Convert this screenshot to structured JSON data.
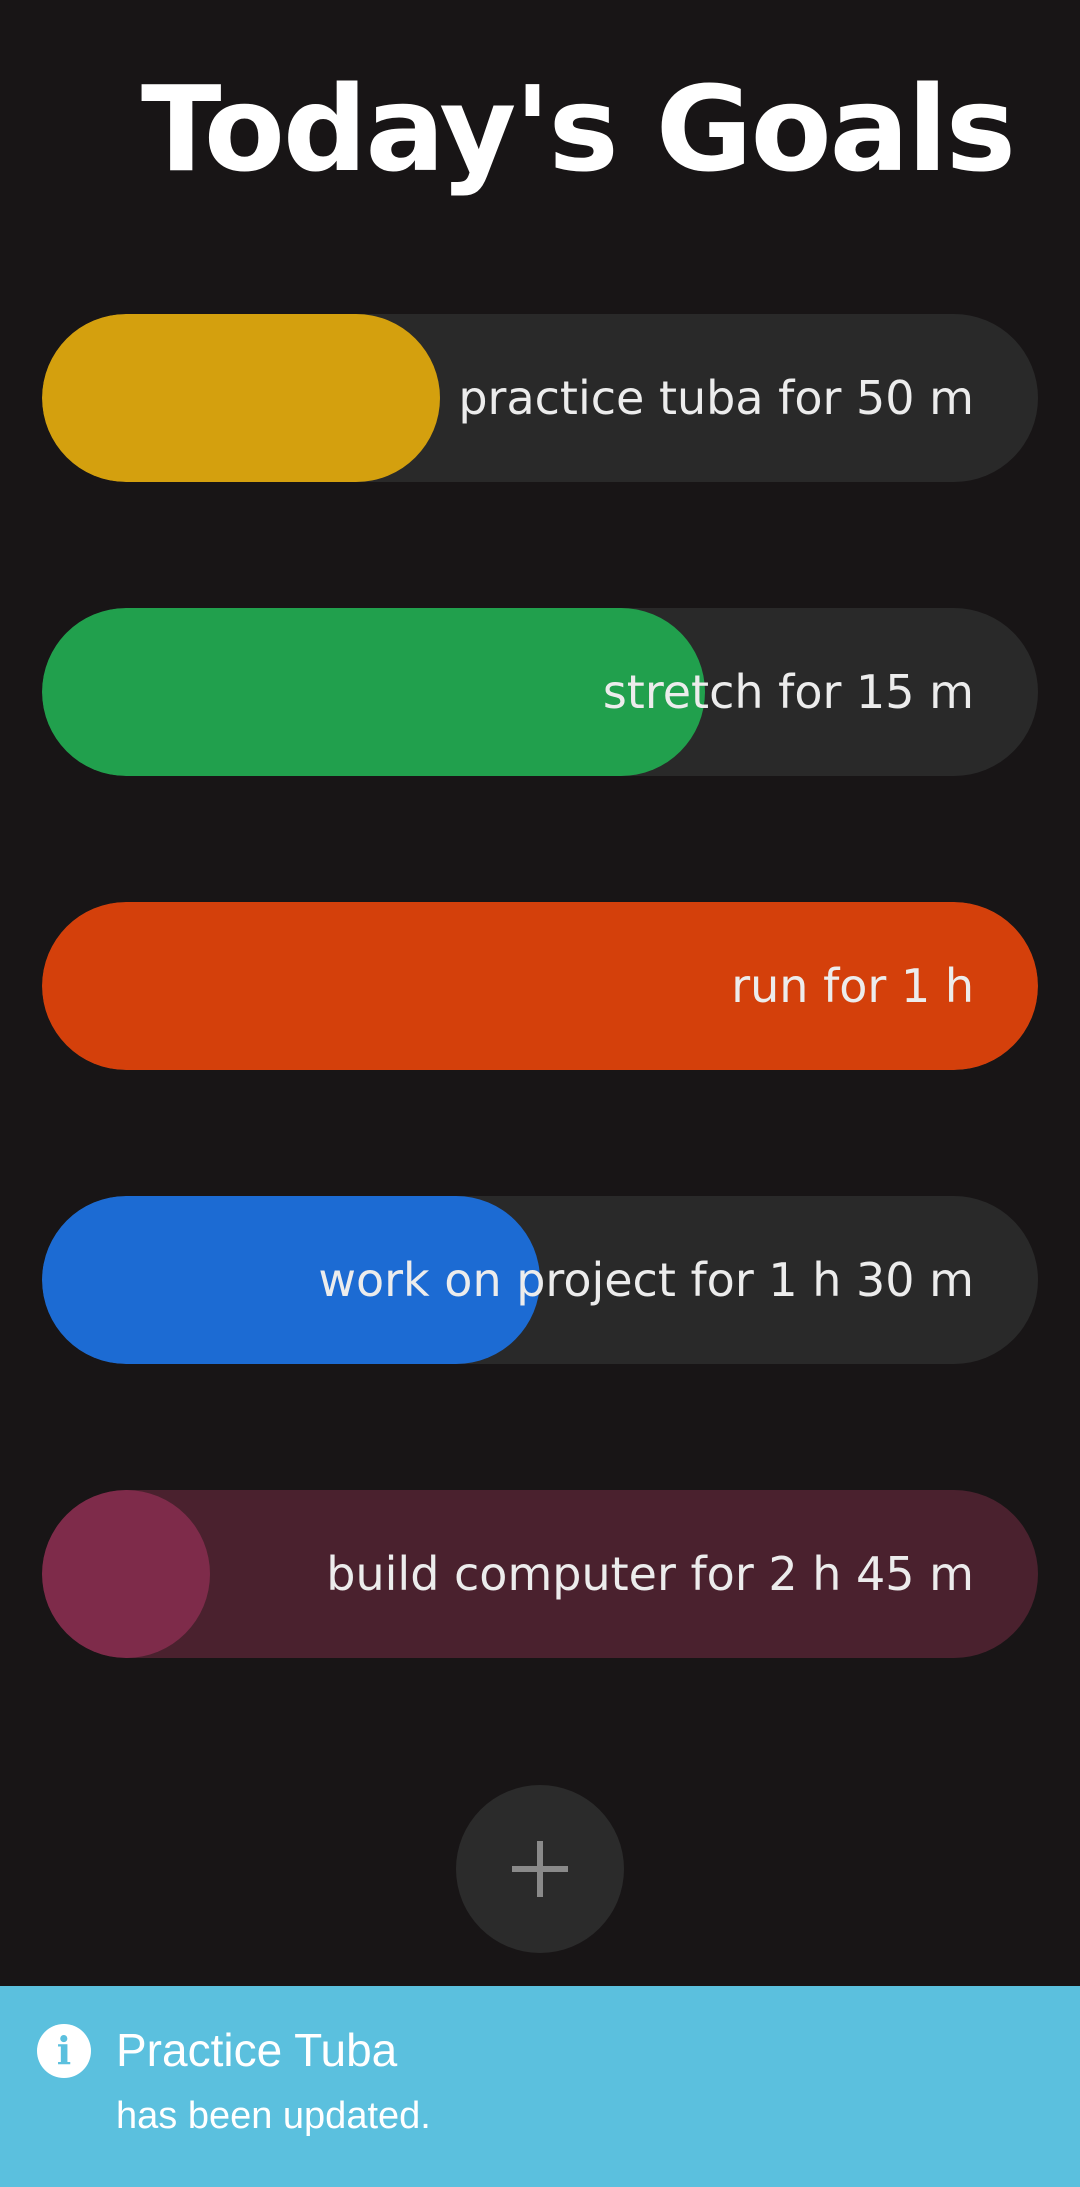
{
  "header": {
    "title": "Today's Goals"
  },
  "goals": [
    {
      "label": "practice tuba for 50 m",
      "progress": 0.4,
      "fill_color": "#d4a00e",
      "track_color": "#292929"
    },
    {
      "label": "stretch for 15 m",
      "progress": 0.666,
      "fill_color": "#21a04d",
      "track_color": "#292929"
    },
    {
      "label": "run for 1 h",
      "progress": 1.0,
      "fill_color": "#d4400b",
      "track_color": "#292929"
    },
    {
      "label": "work on project for 1 h 30 m",
      "progress": 0.5,
      "fill_color": "#1c6bd3",
      "track_color": "#292929"
    },
    {
      "label": "build computer for 2 h 45 m",
      "progress": 0.0,
      "fill_color": "#7e2b4a",
      "track_color": "#4a212e"
    }
  ],
  "add_button": {
    "icon": "plus-icon"
  },
  "toast": {
    "icon": "info-icon",
    "title": "Practice Tuba",
    "message": "has been updated.",
    "background": "#5bc0de"
  }
}
